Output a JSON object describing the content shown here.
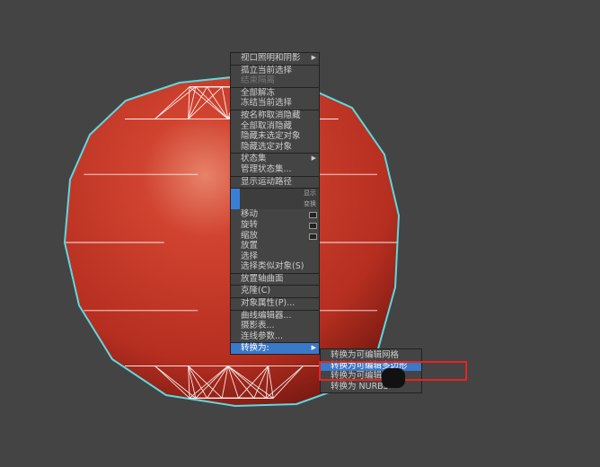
{
  "colors": {
    "background": "#444444",
    "sphere": "#c8392a",
    "wire": "#ffffff",
    "selection": "#5fd8e0",
    "highlight": "#3a78c8",
    "annotation": "#e8231e"
  },
  "menu": {
    "items": [
      {
        "label": "视口照明和阴影",
        "arrow": true
      },
      {
        "label": "孤立当前选择",
        "sep": true
      },
      {
        "label": "结束隔离",
        "dim": true
      },
      {
        "label": "全部解冻",
        "sep": true
      },
      {
        "label": "冻结当前选择"
      },
      {
        "label": "按名称取消隐藏",
        "sep": true
      },
      {
        "label": "全部取消隐藏"
      },
      {
        "label": "隐藏未选定对象"
      },
      {
        "label": "隐藏选定对象"
      },
      {
        "label": "状态集",
        "arrow": true,
        "sep": true
      },
      {
        "label": "管理状态集..."
      },
      {
        "label": "显示运动路径",
        "sep": true
      },
      {
        "quad": "显示",
        "sep": true
      },
      {
        "quad": "变换"
      },
      {
        "label": "移动",
        "box": true
      },
      {
        "label": "旋转",
        "box": true
      },
      {
        "label": "缩放",
        "box": true
      },
      {
        "label": "放置"
      },
      {
        "label": "选择"
      },
      {
        "label": "选择类似对象(S)"
      },
      {
        "label": "放置轴曲面",
        "sep": true
      },
      {
        "label": "克隆(C)",
        "sep": true
      },
      {
        "label": "对象属性(P)...",
        "sep": true
      },
      {
        "label": "曲线编辑器...",
        "sep": true
      },
      {
        "label": "摄影表..."
      },
      {
        "label": "连线参数..."
      },
      {
        "label": "转换为:",
        "arrow": true,
        "sep": true,
        "hl": true
      }
    ]
  },
  "submenu": {
    "items": [
      {
        "label": "转换为可编辑网格"
      },
      {
        "label": "转换为可编辑多边形",
        "hl": true
      },
      {
        "label": "转换为可编辑面片"
      },
      {
        "label": "转换为 NURBS"
      }
    ]
  }
}
